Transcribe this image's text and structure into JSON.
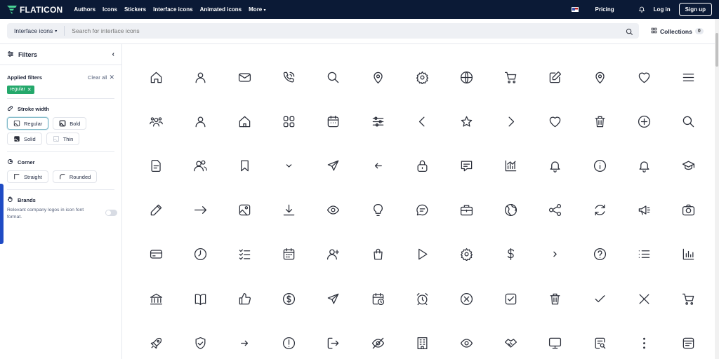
{
  "nav": {
    "logo_text": "FLATICON",
    "links": [
      "Authors",
      "Icons",
      "Stickers",
      "Interface icons",
      "Animated icons",
      "More"
    ],
    "pricing": "Pricing",
    "login": "Log in",
    "signup": "Sign up"
  },
  "search": {
    "select_label": "Interface icons",
    "placeholder": "Search for interface icons",
    "collections_label": "Collections",
    "collections_count": "0"
  },
  "sidebar": {
    "title": "Filters",
    "applied_title": "Applied filters",
    "clear_all": "Clear all",
    "applied_chip": "regular",
    "stroke_title": "Stroke width",
    "stroke_options": [
      "Regular",
      "Bold",
      "Solid",
      "Thin"
    ],
    "corner_title": "Corner",
    "corner_options": [
      "Straight",
      "Rounded"
    ],
    "brands_title": "Brands",
    "brands_desc": "Relevant company logos in icon font format."
  },
  "colors": {
    "nav_bg": "#0b1a36",
    "chip_green": "#24a86b",
    "accent_blue": "#1f4bc4"
  },
  "icon_rows": [
    [
      "home-icon",
      "user-icon",
      "envelope-icon",
      "phone-call-icon",
      "search-icon",
      "marker-icon",
      "settings-icon",
      "globe-icon",
      "shopping-cart-icon",
      "edit-icon",
      "location-icon",
      "heart-icon",
      "menu-burger-icon"
    ],
    [
      "users-icon",
      "user-icon",
      "house-icon",
      "apps-icon",
      "calendar-icon",
      "settings-sliders-icon",
      "angle-left-icon",
      "star-icon",
      "angle-right-icon",
      "heart-icon",
      "trash-icon",
      "add-icon",
      "search-icon"
    ],
    [
      "document-icon",
      "users-alt-icon",
      "bookmark-icon",
      "angle-small-down-icon",
      "paper-plane-icon",
      "arrow-small-left-icon",
      "lock-icon",
      "comment-alt-icon",
      "chart-histogram-icon",
      "bell-icon",
      "info-icon",
      "bell-ring-icon",
      "graduation-cap-icon"
    ],
    [
      "pencil-icon",
      "arrow-right-icon",
      "picture-icon",
      "download-icon",
      "eye-icon",
      "bulb-icon",
      "comment-icon",
      "briefcase-icon",
      "globe-alt-icon",
      "share-icon",
      "refresh-icon",
      "megaphone-icon",
      "camera-icon"
    ],
    [
      "credit-card-icon",
      "clock-icon",
      "list-check-icon",
      "calendar-days-icon",
      "user-add-icon",
      "shopping-bag-icon",
      "play-icon",
      "settings-icon",
      "dollar-icon",
      "angle-small-right-icon",
      "interrogation-icon",
      "list-icon",
      "stats-icon"
    ],
    [
      "bank-icon",
      "book-icon",
      "thumbs-up-icon",
      "coin-icon",
      "paper-plane-icon",
      "calendar-clock-icon",
      "alarm-clock-icon",
      "cross-circle-icon",
      "checkbox-icon",
      "trash-alt-icon",
      "check-icon",
      "cross-icon",
      "cart-icon"
    ],
    [
      "rocket-icon",
      "shield-check-icon",
      "arrow-small-right-icon",
      "exclamation-icon",
      "sign-out-icon",
      "eye-crossed-icon",
      "building-icon",
      "eye-icon",
      "handshake-icon",
      "computer-icon",
      "document-search-icon",
      "menu-dots-vertical-icon",
      "receipt-icon"
    ]
  ]
}
